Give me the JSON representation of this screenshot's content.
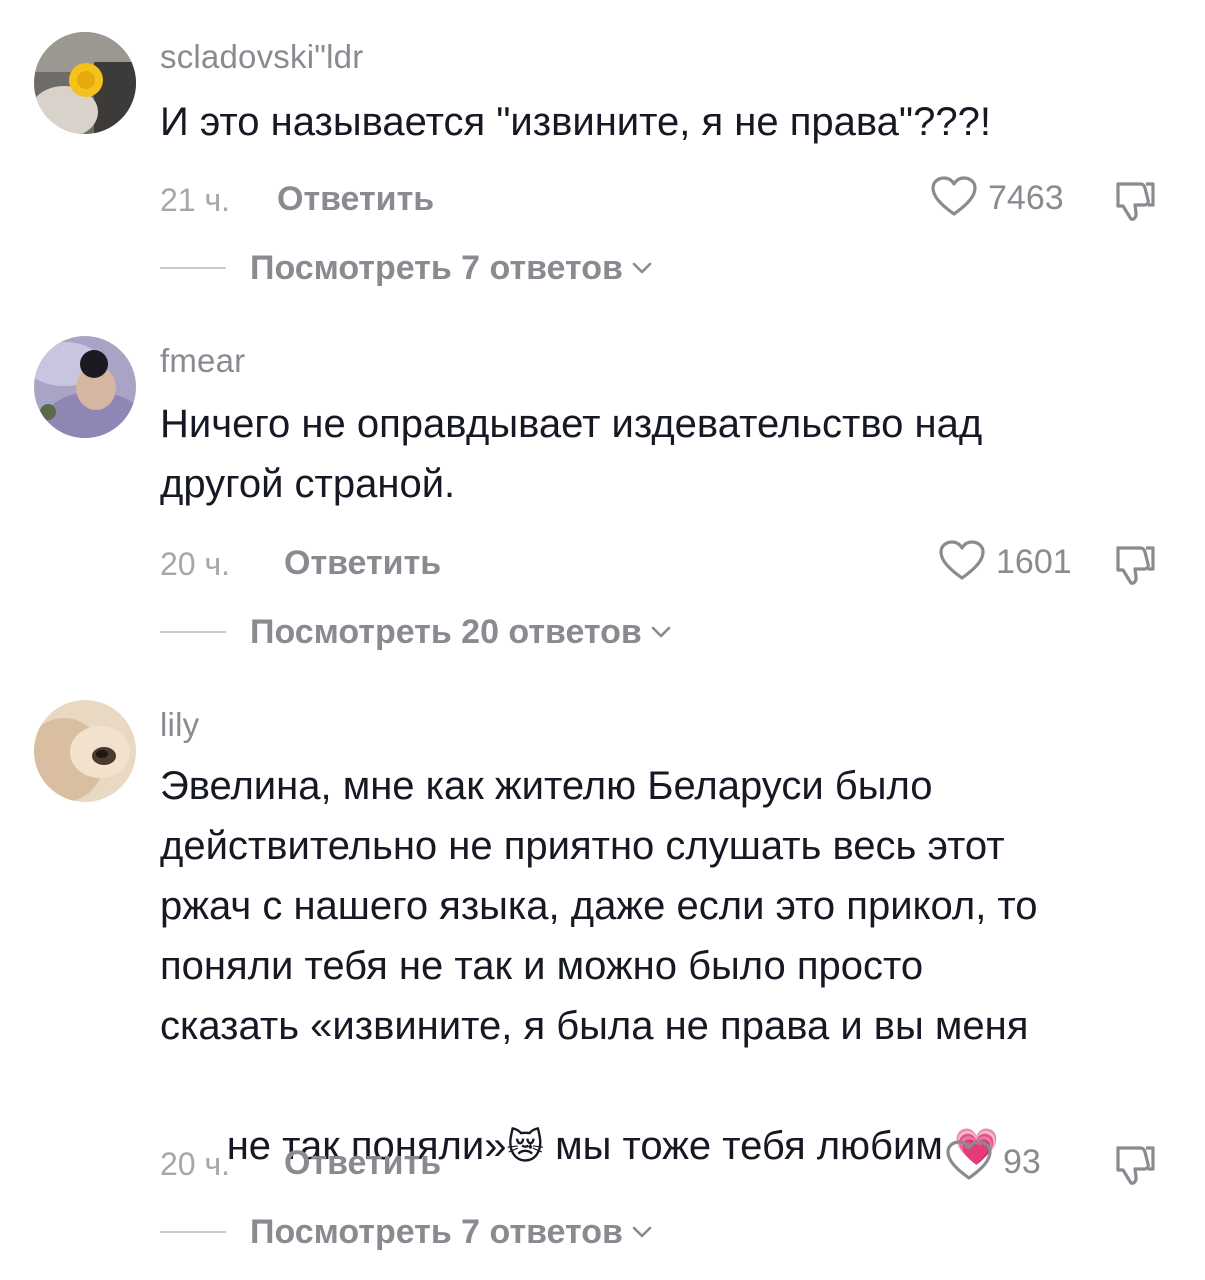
{
  "comments": [
    {
      "username": "scladovski\"ldr",
      "text": "И это называется \"извините, я не права\"???!",
      "time": "21 ч.",
      "reply_label": "Ответить",
      "likes": "7463",
      "view_replies": "Посмотреть 7 ответов"
    },
    {
      "username": "fmear",
      "text_lines": [
        "Ничего не оправдывает издевательство над",
        "другой страной."
      ],
      "time": "20 ч.",
      "reply_label": "Ответить",
      "likes": "1601",
      "view_replies": "Посмотреть 20 ответов"
    },
    {
      "username": "lily",
      "text_lines": [
        "Эвелина, мне как жителю Беларуси было",
        "действительно не приятно слушать весь этот",
        "ржач с нашего языка, даже если это прикол, то",
        "поняли тебя не так и можно было просто",
        "сказать «извините, я была не права и вы меня",
        "не так поняли»",
        " мы тоже тебя любим "
      ],
      "emojis": [
        "😿",
        "💗"
      ],
      "time": "20 ч.",
      "reply_label": "Ответить",
      "likes": "93",
      "view_replies": "Посмотреть 7 ответов"
    }
  ],
  "icons": {
    "like": "heart-outline-icon",
    "dislike": "thumbs-down-icon",
    "expand": "chevron-down-icon"
  },
  "colors": {
    "text": "#161823",
    "secondary": "#8a8b91",
    "muted": "#a6a7ab"
  }
}
